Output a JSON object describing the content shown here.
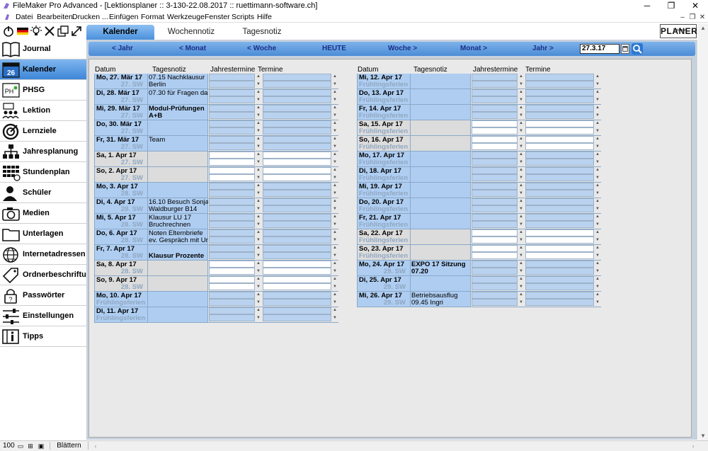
{
  "window": {
    "title": "FileMaker Pro Advanced - [Lektionsplaner :: 3-130-22.08.2017 :: ruettimann-software.ch]",
    "min_label": "─",
    "max_label": "❐",
    "close_label": "✕"
  },
  "menu": [
    "Datei",
    "Bearbeiten",
    "Drucken ...",
    "Einfügen",
    "Format",
    "Werkzeuge",
    "Fenster",
    "Scripts",
    "Hilfe"
  ],
  "mdi_controls": [
    "–",
    "❐",
    "✕"
  ],
  "sidebar": {
    "items": [
      {
        "label": "Journal",
        "icon": "book-icon"
      },
      {
        "label": "Kalender",
        "icon": "calendar-icon",
        "badge": "26",
        "active": true
      },
      {
        "label": "PHSG",
        "icon": "phsg-icon",
        "badge": "PH"
      },
      {
        "label": "Lektion",
        "icon": "class-icon"
      },
      {
        "label": "Lernziele",
        "icon": "target-icon"
      },
      {
        "label": "Jahresplanung",
        "icon": "hierarchy-icon"
      },
      {
        "label": "Stundenplan",
        "icon": "timetable-icon"
      },
      {
        "label": "Schüler",
        "icon": "student-icon"
      },
      {
        "label": "Medien",
        "icon": "camera-icon"
      },
      {
        "label": "Unterlagen",
        "icon": "folder-icon"
      },
      {
        "label": "Internetadressen",
        "icon": "globe-icon"
      },
      {
        "label": "Ordnerbeschriftung",
        "icon": "tag-icon"
      },
      {
        "label": "Passwörter",
        "icon": "lock-icon"
      },
      {
        "label": "Einstellungen",
        "icon": "sliders-icon"
      },
      {
        "label": "Tipps",
        "icon": "info-book-icon"
      }
    ]
  },
  "tabs": [
    "Kalender",
    "Wochennotiz",
    "Tagesnotiz"
  ],
  "logo": {
    "text": "PLANER",
    "small": "Lektions"
  },
  "navbar": {
    "buttons": [
      "< Jahr",
      "< Monat",
      "< Woche",
      "HEUTE",
      "Woche >",
      "Monat >",
      "Jahr >"
    ],
    "date_value": "27.3.17"
  },
  "columns": [
    "Datum",
    "Tagesnotiz",
    "Jahrestermine",
    "Termine"
  ],
  "left_days": [
    {
      "date": "Mo, 27. Mär 17",
      "week": "27. SW",
      "note": [
        "07.15 Nachklausur",
        "Berlin"
      ],
      "type": "wd"
    },
    {
      "date": "Di, 28. Mär 17",
      "week": "27. SW",
      "note": [
        "07.30 für Fragen da",
        ""
      ],
      "type": "wd"
    },
    {
      "date": "Mi, 29. Mär 17",
      "week": "27. SW",
      "note": [
        "Modul-Prüfungen",
        "A+B"
      ],
      "bold": true,
      "type": "wd"
    },
    {
      "date": "Do, 30. Mär 17",
      "week": "27. SW",
      "note": [
        "",
        ""
      ],
      "type": "wd"
    },
    {
      "date": "Fr, 31. Mär 17",
      "week": "27. SW",
      "note": [
        "Team",
        ""
      ],
      "type": "wd"
    },
    {
      "date": "Sa, 1. Apr 17",
      "week": "27. SW",
      "note": [
        "",
        ""
      ],
      "type": "we"
    },
    {
      "date": "So, 2. Apr 17",
      "week": "27. SW",
      "note": [
        "",
        ""
      ],
      "type": "we"
    },
    {
      "date": "Mo, 3. Apr 17",
      "week": "28. SW",
      "note": [
        "",
        ""
      ],
      "type": "wd"
    },
    {
      "date": "Di, 4. Apr 17",
      "week": "28. SW",
      "note": [
        "16.10 Besuch Sonja",
        "Waldburger B14"
      ],
      "type": "wd"
    },
    {
      "date": "Mi, 5. Apr 17",
      "week": "28. SW",
      "note": [
        "Klausur LU 17",
        "Bruchrechnen"
      ],
      "type": "wd"
    },
    {
      "date": "Do, 6. Apr 17",
      "week": "28. SW",
      "note": [
        "Noten Elternbriefe",
        "ev. Gespräch mit Urs"
      ],
      "type": "wd"
    },
    {
      "date": "Fr, 7. Apr 17",
      "week": "28. SW",
      "note": [
        "",
        "Klausur Prozente"
      ],
      "bold2": true,
      "type": "wd"
    },
    {
      "date": "Sa, 8. Apr 17",
      "week": "28. SW",
      "note": [
        "",
        ""
      ],
      "type": "we"
    },
    {
      "date": "So, 9. Apr 17",
      "week": "28. SW",
      "note": [
        "",
        ""
      ],
      "type": "we"
    },
    {
      "date": "Mo, 10. Apr 17",
      "week": "Frühlingsferien 1",
      "note": [
        "",
        ""
      ],
      "type": "wd"
    },
    {
      "date": "Di, 11. Apr 17",
      "week": "Frühlingsferien 1",
      "note": [
        "",
        ""
      ],
      "type": "wd"
    }
  ],
  "right_days": [
    {
      "date": "Mi, 12. Apr 17",
      "week": "Frühlingsferien 1",
      "note": [
        "",
        ""
      ],
      "type": "wd"
    },
    {
      "date": "Do, 13. Apr 17",
      "week": "Frühlingsferien 1",
      "note": [
        "",
        ""
      ],
      "type": "wd"
    },
    {
      "date": "Fr, 14. Apr 17",
      "week": "Frühlingsferien 1",
      "note": [
        "",
        ""
      ],
      "type": "wd"
    },
    {
      "date": "Sa, 15. Apr 17",
      "week": "Frühlingsferien 1",
      "note": [
        "",
        ""
      ],
      "type": "we"
    },
    {
      "date": "So, 16. Apr 17",
      "week": "Frühlingsferien 1",
      "note": [
        "",
        ""
      ],
      "type": "we"
    },
    {
      "date": "Mo, 17. Apr 17",
      "week": "Frühlingsferien 2",
      "note": [
        "",
        ""
      ],
      "type": "wd"
    },
    {
      "date": "Di, 18. Apr 17",
      "week": "Frühlingsferien 2",
      "note": [
        "",
        ""
      ],
      "type": "wd"
    },
    {
      "date": "Mi, 19. Apr 17",
      "week": "Frühlingsferien 2",
      "note": [
        "",
        ""
      ],
      "type": "wd"
    },
    {
      "date": "Do, 20. Apr 17",
      "week": "Frühlingsferien 2",
      "note": [
        "",
        ""
      ],
      "type": "wd"
    },
    {
      "date": "Fr, 21. Apr 17",
      "week": "Frühlingsferien 2",
      "note": [
        "",
        ""
      ],
      "type": "wd"
    },
    {
      "date": "Sa, 22. Apr 17",
      "week": "Frühlingsferien 2",
      "note": [
        "",
        ""
      ],
      "type": "we"
    },
    {
      "date": "So, 23. Apr 17",
      "week": "Frühlingsferien 2",
      "note": [
        "",
        ""
      ],
      "type": "we"
    },
    {
      "date": "Mo, 24. Apr 17",
      "week": "29. SW",
      "note": [
        "EXPO 17 Sitzung",
        "07.20"
      ],
      "bold": true,
      "type": "wd"
    },
    {
      "date": "Di, 25. Apr 17",
      "week": "29. SW",
      "note": [
        "",
        ""
      ],
      "type": "wd"
    },
    {
      "date": "Mi, 26. Apr 17",
      "week": "29. SW",
      "note": [
        "Betriebsausflug",
        "09.45 Ingri"
      ],
      "type": "wd"
    }
  ],
  "status": {
    "zoom": "100",
    "mode": "Blättern"
  },
  "colors": {
    "accent": "#4a90dd",
    "weekday": "#aecdf1",
    "weekend": "#dcdcdc",
    "week_label": "#8fa7c2"
  }
}
